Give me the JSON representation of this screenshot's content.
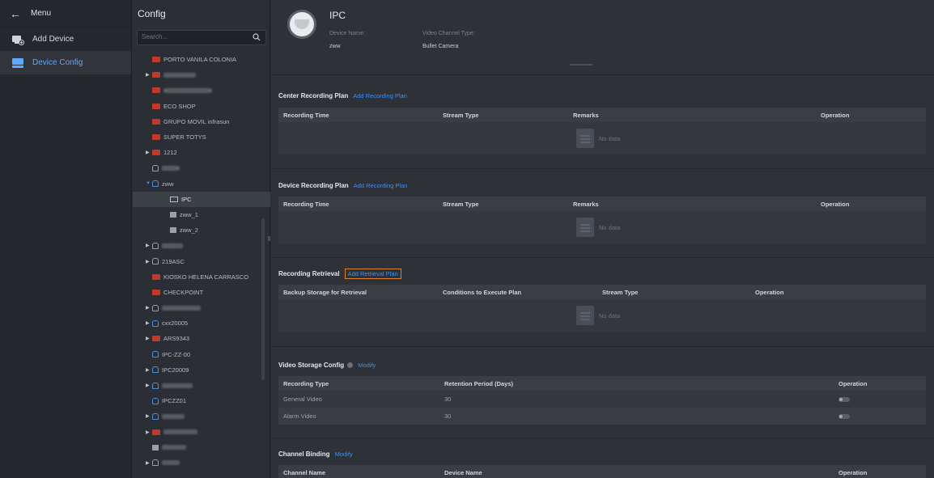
{
  "menu": {
    "back_label": "Menu",
    "items": [
      {
        "label": "Add Device",
        "icon": "add-device-icon",
        "active": false
      },
      {
        "label": "Device Config",
        "icon": "device-config-icon",
        "active": true
      }
    ]
  },
  "config": {
    "title": "Config",
    "search_placeholder": "Search...",
    "tree": [
      {
        "label": "PORTO VANILA COLONIA",
        "icon": "store",
        "arrow": false,
        "indent": 1
      },
      {
        "label": "",
        "icon": "store",
        "arrow": true,
        "indent": 1,
        "blurred": 40
      },
      {
        "label": "",
        "icon": "store",
        "arrow": false,
        "indent": 1,
        "blurred": 60
      },
      {
        "label": "ECO SHOP",
        "icon": "store",
        "arrow": false,
        "indent": 1
      },
      {
        "label": "GRUPO MOVIL infrasun",
        "icon": "store",
        "arrow": false,
        "indent": 1
      },
      {
        "label": "SUPER TOTYS",
        "icon": "store",
        "arrow": false,
        "indent": 1
      },
      {
        "label": "1212",
        "icon": "store",
        "arrow": true,
        "indent": 1
      },
      {
        "label": "",
        "icon": "person",
        "arrow": false,
        "indent": 1,
        "blurred": 22
      },
      {
        "label": "zww",
        "icon": "person-blue",
        "arrow": "open",
        "indent": 1
      },
      {
        "label": "IPC",
        "icon": "ipc",
        "arrow": false,
        "indent": 2,
        "selected": true
      },
      {
        "label": "zww_1",
        "icon": "cam",
        "arrow": false,
        "indent": 2
      },
      {
        "label": "zww_2",
        "icon": "cam",
        "arrow": false,
        "indent": 2
      },
      {
        "label": "",
        "icon": "person",
        "arrow": true,
        "indent": 1,
        "blurred": 26
      },
      {
        "label": "219ASC",
        "icon": "person",
        "arrow": true,
        "indent": 1
      },
      {
        "label": "KIOSKO HELENA CARRASCO",
        "icon": "store",
        "arrow": false,
        "indent": 1
      },
      {
        "label": "CHECKPOINT",
        "icon": "store",
        "arrow": false,
        "indent": 1
      },
      {
        "label": "",
        "icon": "person",
        "arrow": true,
        "indent": 1,
        "blurred": 48
      },
      {
        "label": "cxx20005",
        "icon": "person-blue",
        "arrow": true,
        "indent": 1
      },
      {
        "label": "ARS9343",
        "icon": "store",
        "arrow": true,
        "indent": 1
      },
      {
        "label": "IPC-ZZ-00",
        "icon": "person-blue",
        "arrow": false,
        "indent": 1
      },
      {
        "label": "IPC20009",
        "icon": "person-blue",
        "arrow": true,
        "indent": 1
      },
      {
        "label": "",
        "icon": "person-blue",
        "arrow": true,
        "indent": 1,
        "blurred": 38
      },
      {
        "label": "IPCZZ01",
        "icon": "person-blue",
        "arrow": false,
        "indent": 1
      },
      {
        "label": "",
        "icon": "person-blue",
        "arrow": true,
        "indent": 1,
        "blurred": 28
      },
      {
        "label": "",
        "icon": "store",
        "arrow": true,
        "indent": 1,
        "blurred": 42
      },
      {
        "label": "",
        "icon": "cam",
        "arrow": false,
        "indent": 1,
        "blurred": 30
      },
      {
        "label": "",
        "icon": "person",
        "arrow": true,
        "indent": 1,
        "blurred": 22
      }
    ]
  },
  "device": {
    "name": "IPC",
    "name_label": "Device Name:",
    "name_value": "zww",
    "type_label": "Video Channel Type:",
    "type_value": "Bullet Camera"
  },
  "center_plan": {
    "title": "Center Recording Plan",
    "link": "Add Recording Plan",
    "columns": [
      "Recording Time",
      "Stream Type",
      "Remarks",
      "Operation"
    ],
    "empty": "No data"
  },
  "device_plan": {
    "title": "Device Recording Plan",
    "link": "Add Recording Plan",
    "columns": [
      "Recording Time",
      "Stream Type",
      "Remarks",
      "Operation"
    ],
    "empty": "No data"
  },
  "retrieval": {
    "title": "Recording Retrieval",
    "link": "Add Retrieval Plan",
    "columns": [
      "Backup Storage for Retrieval",
      "Conditions to Execute Plan",
      "Stream Type",
      "Operation"
    ],
    "empty": "No data"
  },
  "storage": {
    "title": "Video Storage Config",
    "link": "Modify",
    "columns": [
      "Recording Type",
      "Retention Period (Days)",
      "Operation"
    ],
    "rows": [
      {
        "type": "General Video",
        "days": "30"
      },
      {
        "type": "Alarm Video",
        "days": "30"
      }
    ]
  },
  "binding": {
    "title": "Channel Binding",
    "link": "Modify",
    "columns": [
      "Channel Name",
      "Device Name",
      "Operation"
    ]
  }
}
